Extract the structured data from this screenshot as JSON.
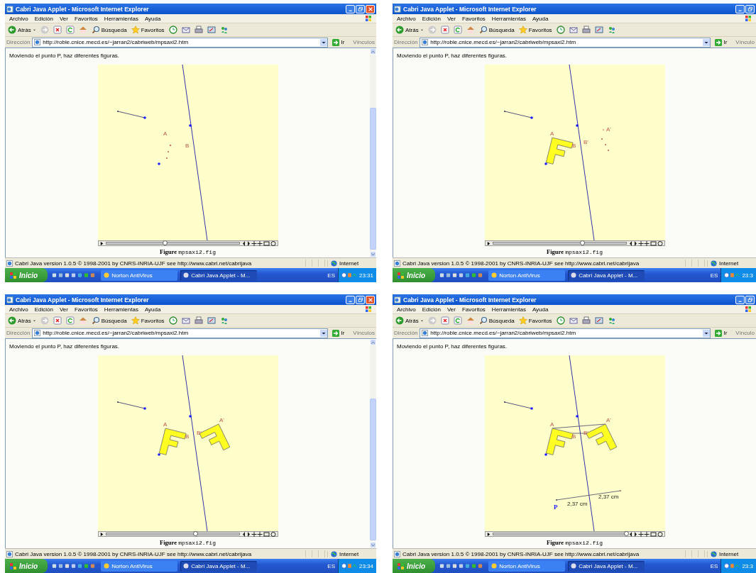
{
  "windows": [
    {
      "title": "Cabri Java Applet - Microsoft Internet Explorer",
      "title_buttons": [
        {
          "kind": "minimize"
        },
        {
          "kind": "maximize"
        },
        {
          "kind": "close"
        }
      ],
      "menu": [
        "Archivo",
        "Edición",
        "Ver",
        "Favoritos",
        "Herramientas",
        "Ayuda"
      ],
      "toolbar": [
        {
          "kind": "back",
          "label": "Atrás"
        },
        {
          "kind": "forward"
        },
        {
          "kind": "stop"
        },
        {
          "kind": "refresh"
        },
        {
          "kind": "home"
        },
        {
          "kind": "search",
          "label": "Búsqueda"
        },
        {
          "kind": "favorites",
          "label": "Favoritos"
        },
        {
          "kind": "history"
        },
        {
          "kind": "mail"
        },
        {
          "kind": "print"
        },
        {
          "kind": "edit"
        },
        {
          "kind": "messenger"
        }
      ],
      "address": {
        "label": "Dirección",
        "value": "http://roble.cnice.mecd.es/~jarran2/cabriweb/mpsaxi2.htm",
        "go": "Ir",
        "links": "Vínculos"
      },
      "page": {
        "intro": "Moviendo el punto P, haz diferentes figuras.",
        "figure": {
          "items": [
            {
              "kind": "segment"
            },
            {
              "kind": "mirror_line"
            },
            {
              "kind": "line_point"
            },
            {
              "kind": "trace_original"
            },
            {
              "kind": "free_point"
            }
          ],
          "labels": [
            {
              "kind": "a",
              "text": "A"
            },
            {
              "kind": "b",
              "text": "B"
            }
          ]
        },
        "slider": {
          "level": 0.44
        },
        "caption_title": "Figure",
        "caption_file": "mpsaxi2.fig"
      },
      "scrollbar": true,
      "status": {
        "text": "Cabri Java version 1.0.5 © 1998-2001 by CNRS-INRIA-UJF see http://www.cabri.net/cabrijava",
        "zone": "Internet"
      },
      "taskbar": {
        "start": "Inicio",
        "tasks": [
          {
            "label": "Norton AntiVirus",
            "selected": false
          },
          {
            "label": "Cabri Java Applet - M...",
            "selected": true
          }
        ],
        "language": "ES",
        "clock": "23:31"
      }
    },
    {
      "title": "Cabri Java Applet - Microsoft Internet Explorer",
      "title_buttons": [
        {
          "kind": "minimize"
        },
        {
          "kind": "maximize"
        }
      ],
      "menu": [
        "Archivo",
        "Edición",
        "Ver",
        "Favoritos",
        "Herramientas",
        "Ayuda"
      ],
      "toolbar": [
        {
          "kind": "back",
          "label": "Atrás"
        },
        {
          "kind": "forward"
        },
        {
          "kind": "stop"
        },
        {
          "kind": "refresh"
        },
        {
          "kind": "home"
        },
        {
          "kind": "search",
          "label": "Búsqueda"
        },
        {
          "kind": "favorites",
          "label": "Favoritos"
        },
        {
          "kind": "history"
        },
        {
          "kind": "mail"
        },
        {
          "kind": "print"
        },
        {
          "kind": "edit"
        },
        {
          "kind": "messenger"
        }
      ],
      "address": {
        "label": "Dirección",
        "value": "http://roble.cnice.mecd.es/~jarran2/cabriweb/mpsaxi2.htm",
        "go": "Ir",
        "links": "Vínculo"
      },
      "page": {
        "intro": "Moviendo el punto P, haz diferentes figuras.",
        "figure": {
          "items": [
            {
              "kind": "segment"
            },
            {
              "kind": "mirror_line"
            },
            {
              "kind": "line_point"
            },
            {
              "kind": "f_original"
            },
            {
              "kind": "free_point"
            },
            {
              "kind": "trace_image"
            }
          ],
          "labels": [
            {
              "kind": "a",
              "text": "A"
            },
            {
              "kind": "b",
              "text": "B"
            },
            {
              "kind": "b_image",
              "text": "B'"
            },
            {
              "kind": "a_image",
              "text": "A'"
            }
          ]
        },
        "slider": {
          "level": 0.67
        },
        "caption_title": "Figure",
        "caption_file": "mpsaxi2.fig"
      },
      "scrollbar": false,
      "status": {
        "text": "Cabri Java version 1.0.5 © 1998-2001 by CNRS-INRIA-UJF see http://www.cabri.net/cabrijava",
        "zone": "Internet"
      },
      "taskbar": {
        "start": "Inicio",
        "tasks": [
          {
            "label": "Norton AntiVirus",
            "selected": false
          },
          {
            "label": "Cabri Java Applet - M...",
            "selected": true
          }
        ],
        "language": "ES",
        "clock": "23:3"
      }
    },
    {
      "title": "Cabri Java Applet - Microsoft Internet Explorer",
      "title_buttons": [
        {
          "kind": "minimize"
        },
        {
          "kind": "maximize"
        },
        {
          "kind": "close"
        }
      ],
      "menu": [
        "Archivo",
        "Edición",
        "Ver",
        "Favoritos",
        "Herramientas",
        "Ayuda"
      ],
      "toolbar": [
        {
          "kind": "back",
          "label": "Atrás"
        },
        {
          "kind": "forward"
        },
        {
          "kind": "stop"
        },
        {
          "kind": "refresh"
        },
        {
          "kind": "home"
        },
        {
          "kind": "search",
          "label": "Búsqueda"
        },
        {
          "kind": "favorites",
          "label": "Favoritos"
        },
        {
          "kind": "history"
        },
        {
          "kind": "mail"
        },
        {
          "kind": "print"
        },
        {
          "kind": "edit"
        },
        {
          "kind": "messenger"
        }
      ],
      "address": {
        "label": "Dirección",
        "value": "http://roble.cnice.mecd.es/~jarran2/cabriweb/mpsaxi2.htm",
        "go": "Ir",
        "links": "Vínculos"
      },
      "page": {
        "intro": "Moviendo el punto P, haz diferentes figuras.",
        "figure": {
          "items": [
            {
              "kind": "segment"
            },
            {
              "kind": "mirror_line"
            },
            {
              "kind": "line_point"
            },
            {
              "kind": "f_original"
            },
            {
              "kind": "free_point"
            },
            {
              "kind": "f_image"
            }
          ],
          "labels": [
            {
              "kind": "a",
              "text": "A"
            },
            {
              "kind": "b",
              "text": "B"
            },
            {
              "kind": "a_image",
              "text": "A'"
            },
            {
              "kind": "b_image",
              "text": "B'"
            }
          ]
        },
        "slider": {
          "level": 0.67
        },
        "caption_title": "Figure",
        "caption_file": "mpsaxi2.fig"
      },
      "scrollbar": true,
      "status": {
        "text": "Cabri Java version 1.0.5 © 1998-2001 by CNRS-INRIA-UJF see http://www.cabri.net/cabrijava",
        "zone": "Internet"
      },
      "taskbar": {
        "start": "Inicio",
        "tasks": [
          {
            "label": "Norton AntiVirus",
            "selected": false
          },
          {
            "label": "Cabri Java Applet - M...",
            "selected": true
          }
        ],
        "language": "ES",
        "clock": "23:34"
      }
    },
    {
      "title": "Cabri Java Applet - Microsoft Internet Explorer",
      "title_buttons": [
        {
          "kind": "minimize"
        },
        {
          "kind": "maximize"
        }
      ],
      "menu": [
        "Archivo",
        "Edición",
        "Ver",
        "Favoritos",
        "Herramientas",
        "Ayuda"
      ],
      "toolbar": [
        {
          "kind": "back",
          "label": "Atrás"
        },
        {
          "kind": "forward"
        },
        {
          "kind": "stop"
        },
        {
          "kind": "refresh"
        },
        {
          "kind": "home"
        },
        {
          "kind": "search",
          "label": "Búsqueda"
        },
        {
          "kind": "favorites",
          "label": "Favoritos"
        },
        {
          "kind": "history"
        },
        {
          "kind": "mail"
        },
        {
          "kind": "print"
        },
        {
          "kind": "edit"
        },
        {
          "kind": "messenger"
        }
      ],
      "address": {
        "label": "Dirección",
        "value": "http://roble.cnice.mecd.es/~jarran2/cabriweb/mpsaxi2.htm",
        "go": "Ir",
        "links": "Vínculo"
      },
      "page": {
        "intro": "Moviendo el punto P, haz diferentes figuras.",
        "figure": {
          "items": [
            {
              "kind": "segment"
            },
            {
              "kind": "mirror_line"
            },
            {
              "kind": "line_point"
            },
            {
              "kind": "link_lines"
            },
            {
              "kind": "f_original"
            },
            {
              "kind": "free_point"
            },
            {
              "kind": "f_image"
            },
            {
              "kind": "distance_line"
            }
          ],
          "labels": [
            {
              "kind": "a",
              "text": "A"
            },
            {
              "kind": "a_image",
              "text": "A'"
            },
            {
              "kind": "b",
              "text": "B"
            },
            {
              "kind": "b_image",
              "text": "B'"
            },
            {
              "kind": "p",
              "text": "P"
            },
            {
              "kind": "dist_left",
              "text": "2,37 cm"
            },
            {
              "kind": "dist_right",
              "text": "2,37 cm"
            }
          ]
        },
        "slider": {
          "level": 1.0
        },
        "caption_title": "Figure",
        "caption_file": "mpsaxi2.fig"
      },
      "scrollbar": false,
      "status": {
        "text": "Cabri Java version 1.0.5 © 1998-2001 by CNRS-INRIA-UJF see http://www.cabri.net/cabrijava",
        "zone": "Internet"
      },
      "taskbar": {
        "start": "Inicio",
        "tasks": [
          {
            "label": "Norton AntiVirus",
            "selected": false
          },
          {
            "label": "Cabri Java Applet - M...",
            "selected": true
          }
        ],
        "language": "ES",
        "clock": "23:3"
      }
    }
  ]
}
